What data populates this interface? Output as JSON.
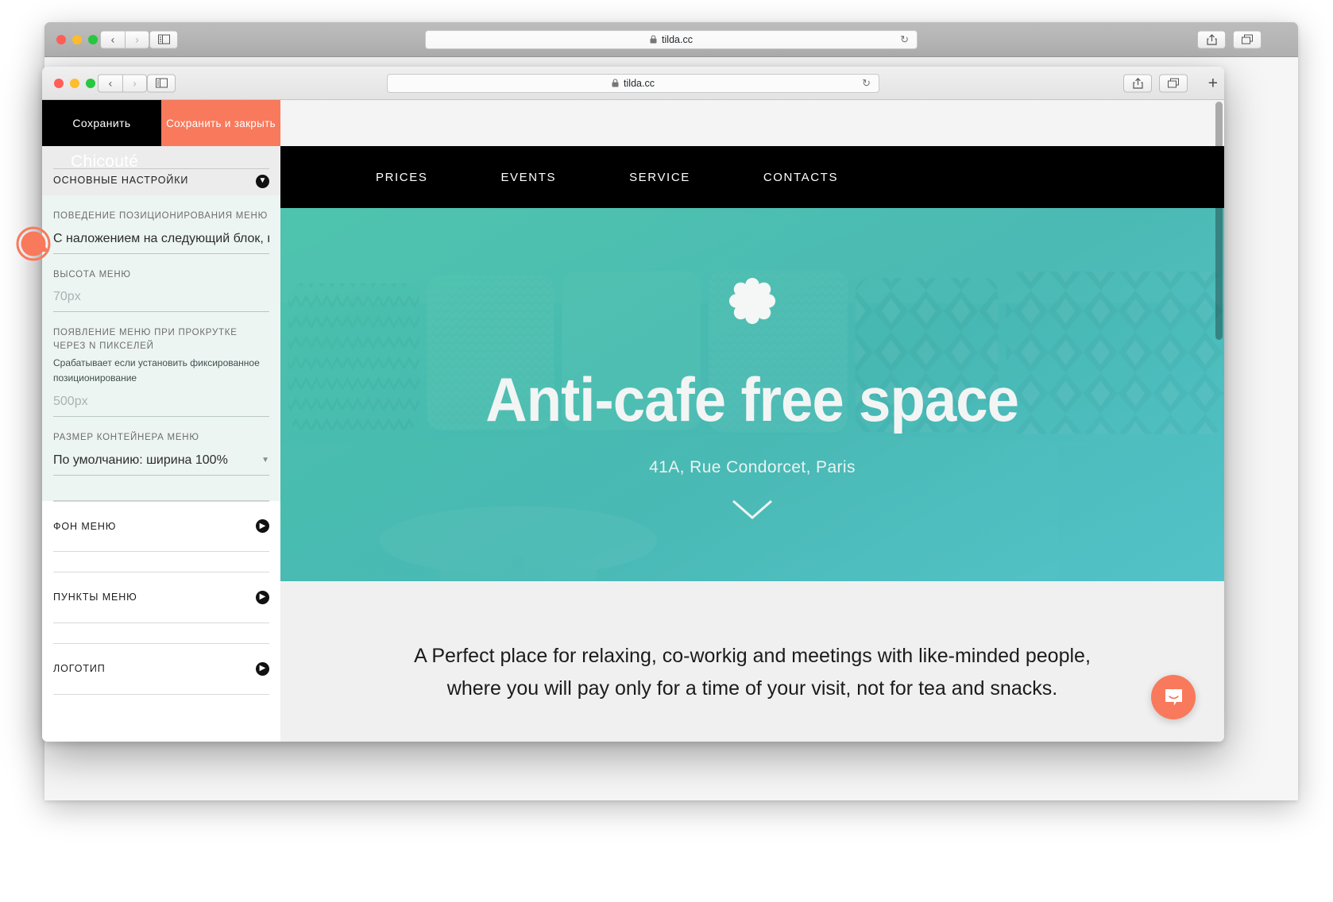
{
  "browser": {
    "back_window": {
      "url": "tilda.cc",
      "lock_icon": "lock-icon",
      "reload_icon": "reload-icon"
    },
    "front_window": {
      "url": "tilda.cc",
      "lock_icon": "lock-icon",
      "reload_icon": "reload-icon",
      "back_arrow": "‹",
      "forward_arrow": "›",
      "sidebar_icon": "sidebar-toggle-icon",
      "share_icon": "share-icon",
      "tabs_icon": "show-tabs-icon",
      "new_tab_label": "+"
    }
  },
  "sidebar": {
    "save_label": "Сохранить",
    "save_close_label": "Сохранить и закрыть",
    "project_title": "Chicouté",
    "main_settings_label": "ОСНОВНЫЕ НАСТРОЙКИ",
    "fields": [
      {
        "label": "ПОВЕДЕНИЕ ПОЗИЦИОНИРОВАНИЯ МЕНЮ",
        "hint": "",
        "value": "С наложением на следующий блок, но б",
        "placeholder": false,
        "select": false
      },
      {
        "label": "ВЫСОТА МЕНЮ",
        "hint": "",
        "value": "70px",
        "placeholder": true,
        "select": false
      },
      {
        "label": "ПОЯВЛЕНИЕ МЕНЮ ПРИ ПРОКРУТКЕ ЧЕРЕЗ N ПИКСЕЛЕЙ",
        "hint": "Срабатывает если установить фиксированное позиционирование",
        "value": "500px",
        "placeholder": true,
        "select": false
      },
      {
        "label": "РАЗМЕР КОНТЕЙНЕРА МЕНЮ",
        "hint": "",
        "value": "По умолчанию: ширина 100%",
        "placeholder": false,
        "select": true
      }
    ],
    "accordions": [
      {
        "label": "ФОН МЕНЮ",
        "icon": "arrow-right-circle-icon"
      },
      {
        "label": "ПУНКТЫ МЕНЮ",
        "icon": "arrow-right-circle-icon"
      },
      {
        "label": "ЛОГОТИП",
        "icon": "arrow-right-circle-icon"
      }
    ],
    "expand_icon": "arrow-down-circle-icon"
  },
  "site": {
    "nav": [
      {
        "label": "PRICES"
      },
      {
        "label": "EVENTS"
      },
      {
        "label": "SERVICE"
      },
      {
        "label": "CONTACTS"
      }
    ],
    "logo_icon": "flower-logo-icon",
    "hero_title": "Anti-cafe free space",
    "hero_subtitle": "41A, Rue Condorcet, Paris",
    "scroll_chevron_icon": "chevron-down-icon",
    "body_line1": "A Perfect place for relaxing, co-workig and meetings with like-minded people,",
    "body_line2": "where you will pay only for a time of your visit, not for tea and snacks."
  },
  "widgets": {
    "intercom_icon": "intercom-chat-icon",
    "cursor_marker_icon": "cursor-marker-icon"
  },
  "colors": {
    "accent_orange": "#f8795c",
    "nav_black": "#000000",
    "hero_teal": "#49b7ab",
    "sidebar_field_bg": "#edf5f3"
  }
}
